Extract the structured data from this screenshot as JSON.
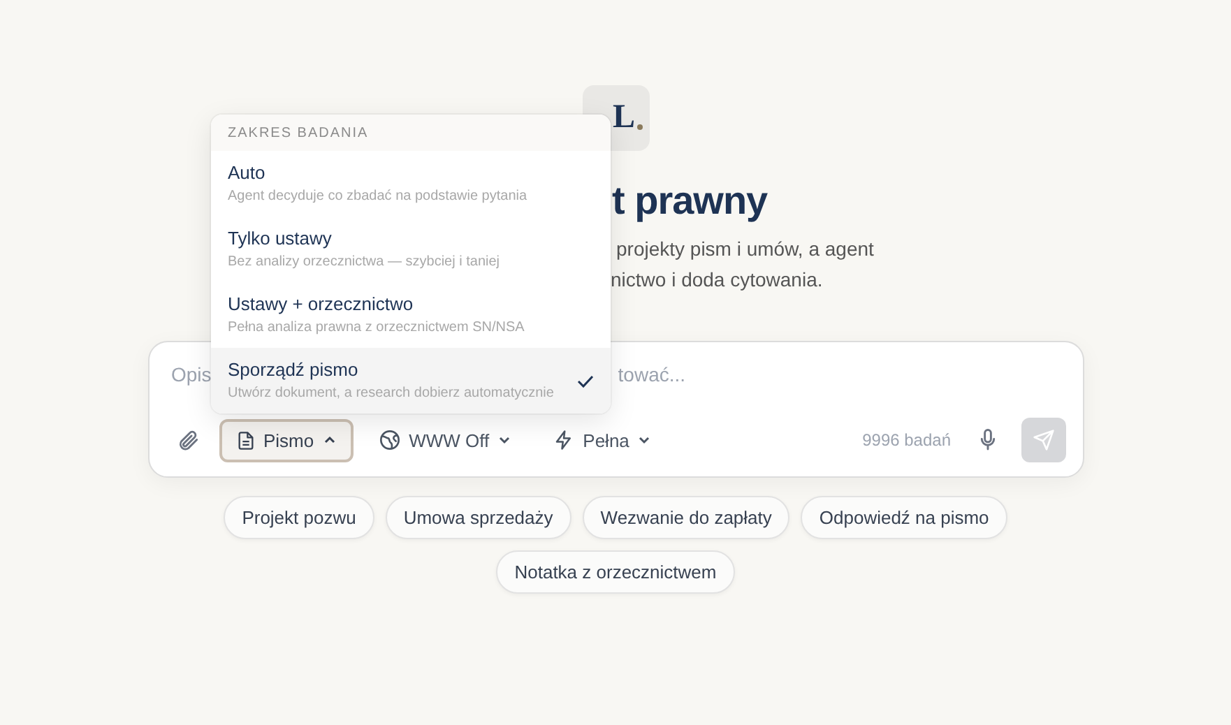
{
  "logo": {
    "letter": "L"
  },
  "title": "t prawny",
  "subtitle_lines": [
    "projekty pism i umów, a agent",
    "nictwo i doda cytowania."
  ],
  "composer": {
    "placeholder_fragments": [
      "Opis",
      "tować..."
    ],
    "mode": {
      "label": "Pismo",
      "expanded": true
    },
    "web": {
      "label": "WWW Off",
      "expanded": false
    },
    "depth": {
      "label": "Pełna",
      "expanded": false
    },
    "count": "9996 badań",
    "send_disabled": true
  },
  "dropdown": {
    "heading": "ZAKRES BADANIA",
    "items": [
      {
        "title": "Auto",
        "description": "Agent decyduje co zbadać na podstawie pytania",
        "selected": false
      },
      {
        "title": "Tylko ustawy",
        "description": "Bez analizy orzecznictwa — szybciej i taniej",
        "selected": false
      },
      {
        "title": "Ustawy + orzecznictwo",
        "description": "Pełna analiza prawna z orzecznictwem SN/NSA",
        "selected": false
      },
      {
        "title": "Sporządź pismo",
        "description": "Utwórz dokument, a research dobierz automatycznie",
        "selected": true
      }
    ]
  },
  "suggestions": [
    [
      "Projekt pozwu",
      "Umowa sprzedaży",
      "Wezwanie do zapłaty",
      "Odpowiedź na pismo"
    ],
    [
      "Notatka z orzecznictwem"
    ]
  ]
}
